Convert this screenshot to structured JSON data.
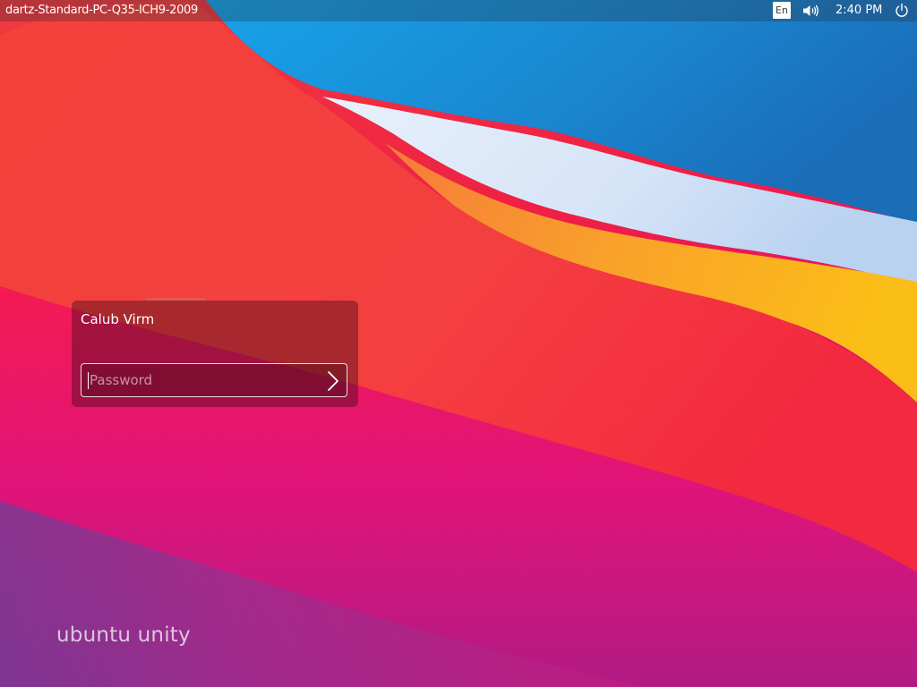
{
  "top_panel": {
    "hostname": "dartz-Standard-PC-Q35-ICH9-2009",
    "keyboard_layout": "En",
    "volume_icon": "speaker-volume-icon",
    "clock": "2:40 PM",
    "power_icon": "power-icon"
  },
  "login": {
    "user_name": "Calub Virm",
    "password_placeholder": "Password",
    "password_value": "",
    "submit_icon": "chevron-right-icon"
  },
  "branding": {
    "text": "ubuntu unity"
  },
  "colors": {
    "wallpaper_red": "#f2273d",
    "wallpaper_orange": "#f98a2c",
    "wallpaper_yellow": "#fbb81d",
    "wallpaper_blue": "#1c8cd6",
    "wallpaper_magenta": "#c3127a",
    "wallpaper_purple": "#7d3f95"
  }
}
